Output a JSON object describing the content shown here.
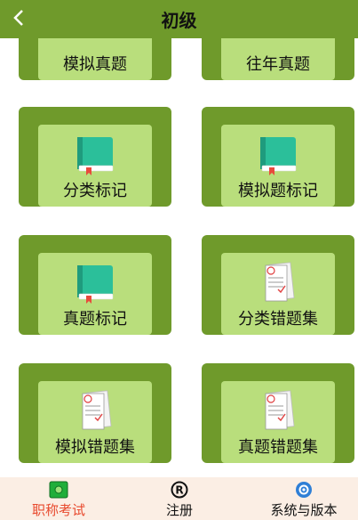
{
  "header": {
    "title": "初级",
    "back_icon": "chevron-left-icon"
  },
  "menu": [
    {
      "label": "模拟真题",
      "icon": ""
    },
    {
      "label": "往年真题",
      "icon": ""
    },
    {
      "label": "分类标记",
      "icon": "book-icon"
    },
    {
      "label": "模拟题标记",
      "icon": "book-icon"
    },
    {
      "label": "真题标记",
      "icon": "book-icon"
    },
    {
      "label": "分类错题集",
      "icon": "graded-paper-icon"
    },
    {
      "label": "模拟错题集",
      "icon": "graded-paper-icon"
    },
    {
      "label": "真题错题集",
      "icon": "graded-paper-icon"
    }
  ],
  "tabbar": {
    "items": [
      {
        "label": "职称考试",
        "icon": "exam-icon",
        "active": true
      },
      {
        "label": "注册",
        "icon": "registered-icon",
        "active": false
      },
      {
        "label": "系统与版本",
        "icon": "system-icon",
        "active": false
      }
    ],
    "active_color": "#e84a2e",
    "background": "#fbeee4"
  },
  "colors": {
    "primary": "#6f9a2b",
    "card_inner": "#b9de7c"
  }
}
